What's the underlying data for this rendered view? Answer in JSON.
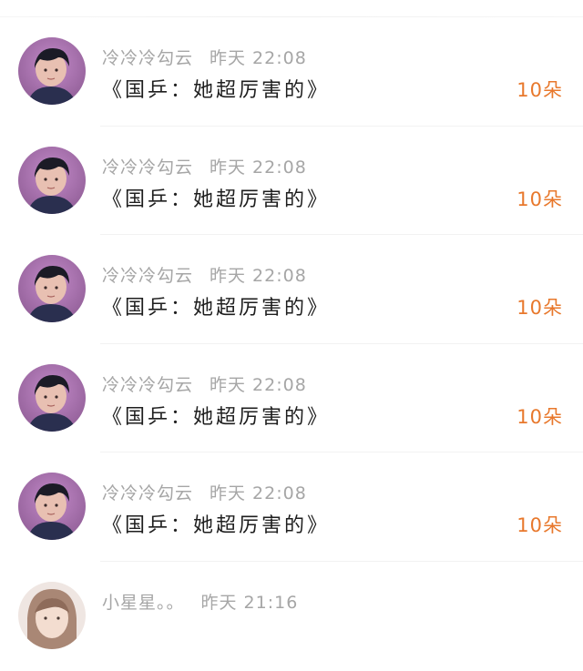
{
  "comments": [
    {
      "username": "冷冷冷勾云",
      "time": "昨天 22:08",
      "title": "《国乒：她超厉害的》",
      "gift": "10朵"
    },
    {
      "username": "冷冷冷勾云",
      "time": "昨天 22:08",
      "title": "《国乒：她超厉害的》",
      "gift": "10朵"
    },
    {
      "username": "冷冷冷勾云",
      "time": "昨天 22:08",
      "title": "《国乒：她超厉害的》",
      "gift": "10朵"
    },
    {
      "username": "冷冷冷勾云",
      "time": "昨天 22:08",
      "title": "《国乒：她超厉害的》",
      "gift": "10朵"
    },
    {
      "username": "冷冷冷勾云",
      "time": "昨天 22:08",
      "title": "《国乒：她超厉害的》",
      "gift": "10朵"
    },
    {
      "username": "小星星。。",
      "time": "昨天 21:16"
    }
  ],
  "colors": {
    "gift_accent": "#e8782c",
    "meta_text": "#a6a6a6",
    "title_text": "#1e1e1e"
  },
  "icons": {
    "avatar_primary": "avatar-icon",
    "avatar_secondary": "avatar-icon"
  }
}
